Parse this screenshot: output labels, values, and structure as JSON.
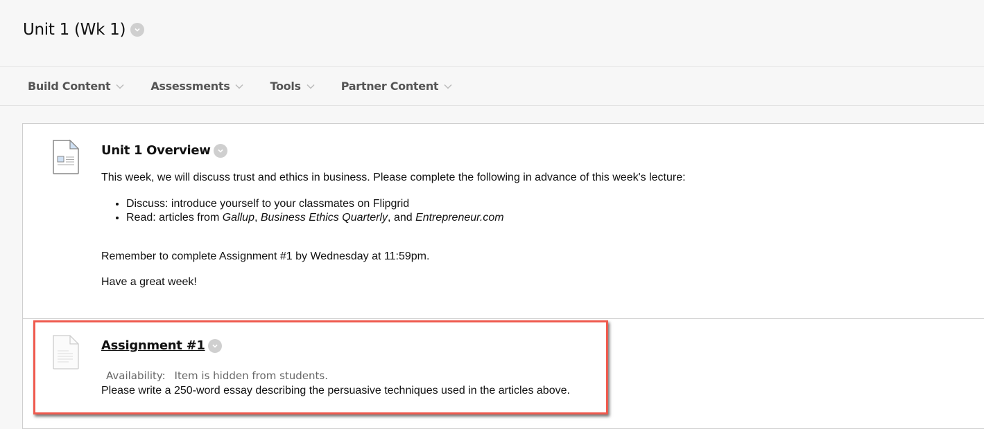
{
  "page": {
    "title": "Unit 1 (Wk 1)",
    "title_menu_icon": "chevron-down-circle-icon"
  },
  "action_bar": {
    "items": [
      {
        "label": "Build Content",
        "icon": "chevron-down-icon"
      },
      {
        "label": "Assessments",
        "icon": "chevron-down-icon"
      },
      {
        "label": "Tools",
        "icon": "chevron-down-icon"
      },
      {
        "label": "Partner Content",
        "icon": "chevron-down-icon"
      }
    ]
  },
  "content": {
    "items": [
      {
        "title": "Unit 1 Overview",
        "icon": "document-item-icon",
        "intro": "This week, we will discuss trust and ethics in business. Please complete the following in advance of this week's lecture:",
        "bullets": [
          {
            "text": "Discuss: introduce yourself to your classmates on Flipgrid"
          },
          {
            "prefix": "Read: articles from ",
            "italic1": "Gallup",
            "sep1": ", ",
            "italic2": "Business Ethics Quarterly",
            "sep2": ", and ",
            "italic3": "Entrepreneur.com"
          }
        ],
        "reminder": "Remember to complete Assignment #1 by Wednesday at 11:59pm.",
        "closing": "Have a great week!"
      },
      {
        "title": "Assignment #1",
        "icon": "blank-document-icon",
        "availability_label": "Availability:",
        "availability_value": "Item is hidden from students.",
        "description": "Please write a 250-word essay describing the persuasive techniques used in the articles above."
      }
    ]
  },
  "colors": {
    "highlight_border": "#ef5a4e",
    "background": "#f7f7f7",
    "chevron_circle": "#cfcfcf"
  }
}
